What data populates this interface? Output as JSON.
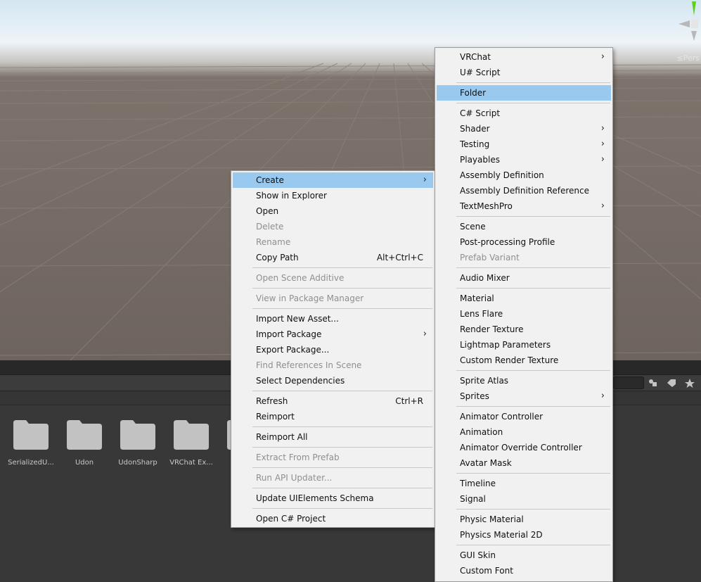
{
  "scene": {
    "persp_label": "≤Pers"
  },
  "project": {
    "assets": [
      {
        "label": "SerializedU..."
      },
      {
        "label": "Udon"
      },
      {
        "label": "UdonSharp"
      },
      {
        "label": "VRChat Ex..."
      }
    ]
  },
  "context_menu": {
    "items": [
      {
        "label": "Create",
        "submenu": true,
        "highlighted": true
      },
      {
        "label": "Show in Explorer"
      },
      {
        "label": "Open"
      },
      {
        "label": "Delete",
        "disabled": true
      },
      {
        "label": "Rename",
        "disabled": true
      },
      {
        "label": "Copy Path",
        "shortcut": "Alt+Ctrl+C"
      },
      {
        "label": "Open Scene Additive",
        "disabled": true
      },
      {
        "label": "View in Package Manager",
        "disabled": true
      },
      {
        "label": "Import New Asset..."
      },
      {
        "label": "Import Package",
        "submenu": true
      },
      {
        "label": "Export Package..."
      },
      {
        "label": "Find References In Scene",
        "disabled": true
      },
      {
        "label": "Select Dependencies"
      },
      {
        "label": "Refresh",
        "shortcut": "Ctrl+R"
      },
      {
        "label": "Reimport"
      },
      {
        "label": "Reimport All"
      },
      {
        "label": "Extract From Prefab",
        "disabled": true
      },
      {
        "label": "Run API Updater...",
        "disabled": true
      },
      {
        "label": "Update UIElements Schema"
      },
      {
        "label": "Open C# Project"
      }
    ]
  },
  "create_submenu": {
    "items": [
      {
        "label": "VRChat",
        "submenu": true
      },
      {
        "label": "U# Script"
      },
      {
        "label": "Folder",
        "highlighted": true
      },
      {
        "label": "C# Script"
      },
      {
        "label": "Shader",
        "submenu": true
      },
      {
        "label": "Testing",
        "submenu": true
      },
      {
        "label": "Playables",
        "submenu": true
      },
      {
        "label": "Assembly Definition"
      },
      {
        "label": "Assembly Definition Reference"
      },
      {
        "label": "TextMeshPro",
        "submenu": true
      },
      {
        "label": "Scene"
      },
      {
        "label": "Post-processing Profile"
      },
      {
        "label": "Prefab Variant",
        "disabled": true
      },
      {
        "label": "Audio Mixer"
      },
      {
        "label": "Material"
      },
      {
        "label": "Lens Flare"
      },
      {
        "label": "Render Texture"
      },
      {
        "label": "Lightmap Parameters"
      },
      {
        "label": "Custom Render Texture"
      },
      {
        "label": "Sprite Atlas"
      },
      {
        "label": "Sprites",
        "submenu": true
      },
      {
        "label": "Animator Controller"
      },
      {
        "label": "Animation"
      },
      {
        "label": "Animator Override Controller"
      },
      {
        "label": "Avatar Mask"
      },
      {
        "label": "Timeline"
      },
      {
        "label": "Signal"
      },
      {
        "label": "Physic Material"
      },
      {
        "label": "Physics Material 2D"
      },
      {
        "label": "GUI Skin"
      },
      {
        "label": "Custom Font"
      }
    ]
  },
  "colors": {
    "menu_bg": "#f1f1f1",
    "highlight": "#99c9ef",
    "disabled_text": "#8f8f8f",
    "panel_bg": "#383838",
    "gizmo_green": "#5fd01e"
  }
}
